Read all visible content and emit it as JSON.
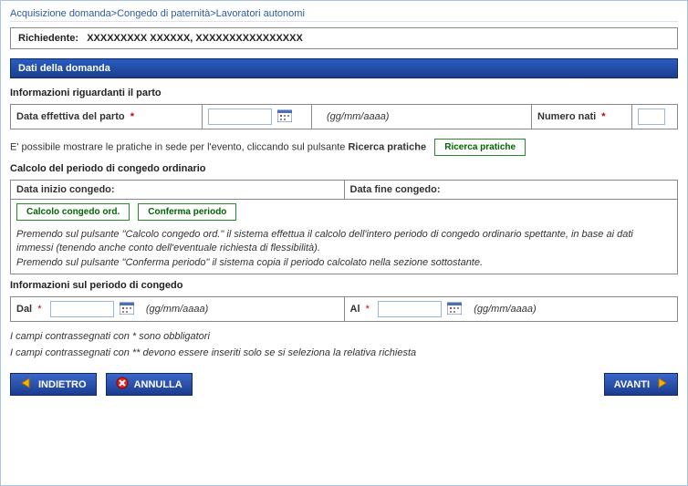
{
  "breadcrumb": "Acquisizione domanda>Congedo di paternità>Lavoratori autonomi",
  "applicant": {
    "label": "Richiedente:",
    "value": "XXXXXXXXX XXXXXX, XXXXXXXXXXXXXXXX"
  },
  "section_title": "Dati della domanda",
  "birth_info": {
    "heading": "Informazioni riguardanti il parto",
    "date_label": "Data effettiva del parto",
    "date_value": "",
    "date_format": "(gg/mm/aaaa)",
    "count_label": "Numero nati",
    "count_value": ""
  },
  "search_line": {
    "text_prefix": "E' possibile mostrare le pratiche in sede per l'evento, cliccando sul pulsante ",
    "text_bold": "Ricerca pratiche",
    "button": "Ricerca pratiche"
  },
  "leave_calc": {
    "heading": "Calcolo del periodo di congedo ordinario",
    "start_label": "Data inizio congedo:",
    "end_label": "Data fine congedo:",
    "btn_calc": "Calcolo congedo ord.",
    "btn_confirm": "Conferma periodo",
    "hint1": "Premendo sul pulsante \"Calcolo congedo ord.\" il sistema effettua il calcolo dell'intero periodo di congedo ordinario spettante, in base ai dati immessi (tenendo anche conto dell'eventuale richiesta di flessibilità).",
    "hint2": "Premendo sul pulsante \"Conferma periodo\" il sistema copia il periodo calcolato nella sezione sottostante."
  },
  "period_info": {
    "heading": "Informazioni sul periodo di congedo",
    "from_label": "Dal",
    "from_value": "",
    "to_label": "Al",
    "to_value": "",
    "format": "(gg/mm/aaaa)"
  },
  "mandatory": {
    "line1": "I campi contrassegnati con * sono obbligatori",
    "line2": "I campi contrassegnati con ** devono essere inseriti solo se si seleziona la relativa richiesta"
  },
  "nav": {
    "back": "INDIETRO",
    "cancel": "ANNULLA",
    "next": "AVANTI"
  }
}
